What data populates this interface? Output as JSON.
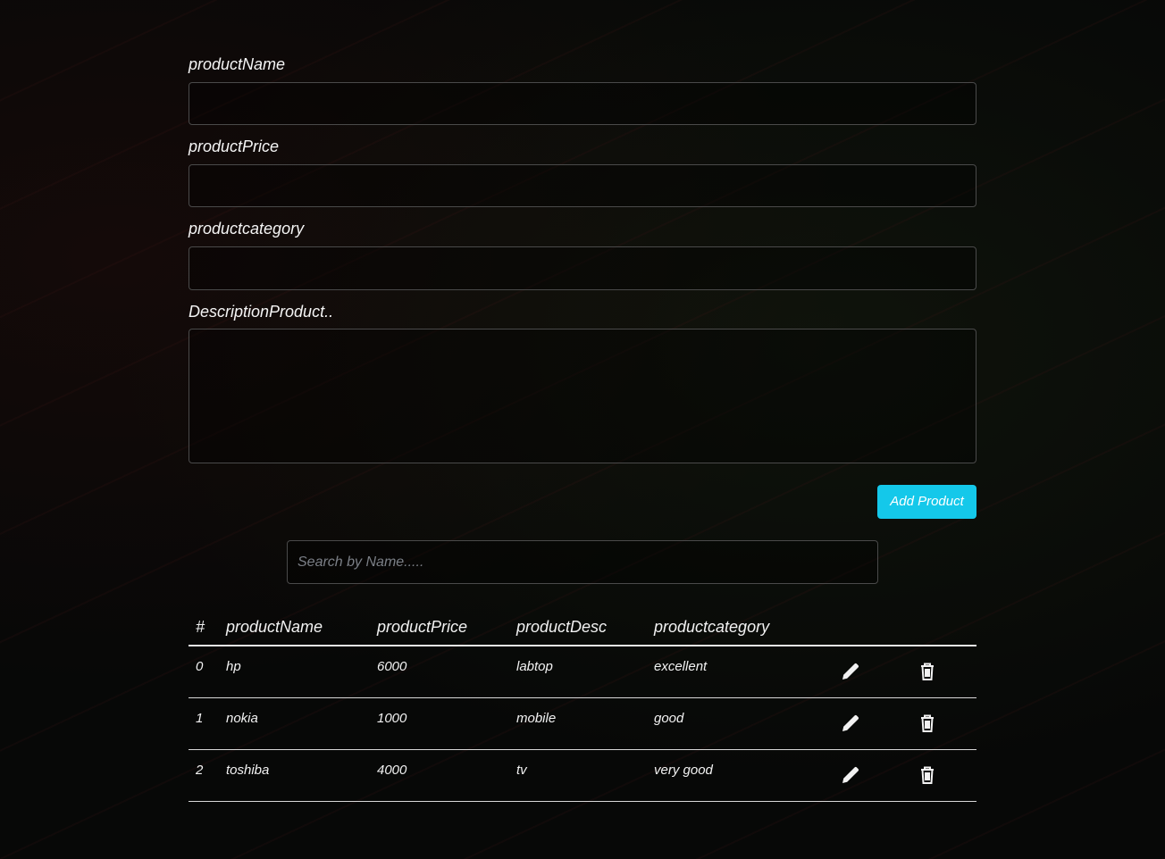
{
  "form": {
    "fields": [
      {
        "label": "productName",
        "value": ""
      },
      {
        "label": "productPrice",
        "value": ""
      },
      {
        "label": "productcategory",
        "value": ""
      }
    ],
    "description_label": "DescriptionProduct..",
    "description_value": "",
    "add_button": "Add Product"
  },
  "search": {
    "placeholder": "Search by Name....."
  },
  "table": {
    "headers": [
      "#",
      "productName",
      "productPrice",
      "productDesc",
      "productcategory"
    ],
    "rows": [
      {
        "index": "0",
        "name": "hp",
        "price": "6000",
        "desc": "labtop",
        "category": "excellent"
      },
      {
        "index": "1",
        "name": "nokia",
        "price": "1000",
        "desc": "mobile",
        "category": "good"
      },
      {
        "index": "2",
        "name": "toshiba",
        "price": "4000",
        "desc": "tv",
        "category": "very good"
      }
    ]
  },
  "colors": {
    "accent": "#14c8ea",
    "background": "#070807"
  }
}
